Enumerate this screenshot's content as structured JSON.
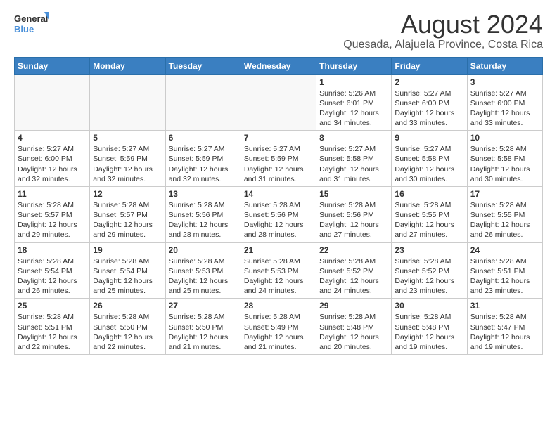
{
  "logo": {
    "line1": "General",
    "line2": "Blue"
  },
  "title": "August 2024",
  "subtitle": "Quesada, Alajuela Province, Costa Rica",
  "days_header": [
    "Sunday",
    "Monday",
    "Tuesday",
    "Wednesday",
    "Thursday",
    "Friday",
    "Saturday"
  ],
  "weeks": [
    [
      {
        "day": "",
        "info": ""
      },
      {
        "day": "",
        "info": ""
      },
      {
        "day": "",
        "info": ""
      },
      {
        "day": "",
        "info": ""
      },
      {
        "day": "1",
        "info": "Sunrise: 5:26 AM\nSunset: 6:01 PM\nDaylight: 12 hours\nand 34 minutes."
      },
      {
        "day": "2",
        "info": "Sunrise: 5:27 AM\nSunset: 6:00 PM\nDaylight: 12 hours\nand 33 minutes."
      },
      {
        "day": "3",
        "info": "Sunrise: 5:27 AM\nSunset: 6:00 PM\nDaylight: 12 hours\nand 33 minutes."
      }
    ],
    [
      {
        "day": "4",
        "info": "Sunrise: 5:27 AM\nSunset: 6:00 PM\nDaylight: 12 hours\nand 32 minutes."
      },
      {
        "day": "5",
        "info": "Sunrise: 5:27 AM\nSunset: 5:59 PM\nDaylight: 12 hours\nand 32 minutes."
      },
      {
        "day": "6",
        "info": "Sunrise: 5:27 AM\nSunset: 5:59 PM\nDaylight: 12 hours\nand 32 minutes."
      },
      {
        "day": "7",
        "info": "Sunrise: 5:27 AM\nSunset: 5:59 PM\nDaylight: 12 hours\nand 31 minutes."
      },
      {
        "day": "8",
        "info": "Sunrise: 5:27 AM\nSunset: 5:58 PM\nDaylight: 12 hours\nand 31 minutes."
      },
      {
        "day": "9",
        "info": "Sunrise: 5:27 AM\nSunset: 5:58 PM\nDaylight: 12 hours\nand 30 minutes."
      },
      {
        "day": "10",
        "info": "Sunrise: 5:28 AM\nSunset: 5:58 PM\nDaylight: 12 hours\nand 30 minutes."
      }
    ],
    [
      {
        "day": "11",
        "info": "Sunrise: 5:28 AM\nSunset: 5:57 PM\nDaylight: 12 hours\nand 29 minutes."
      },
      {
        "day": "12",
        "info": "Sunrise: 5:28 AM\nSunset: 5:57 PM\nDaylight: 12 hours\nand 29 minutes."
      },
      {
        "day": "13",
        "info": "Sunrise: 5:28 AM\nSunset: 5:56 PM\nDaylight: 12 hours\nand 28 minutes."
      },
      {
        "day": "14",
        "info": "Sunrise: 5:28 AM\nSunset: 5:56 PM\nDaylight: 12 hours\nand 28 minutes."
      },
      {
        "day": "15",
        "info": "Sunrise: 5:28 AM\nSunset: 5:56 PM\nDaylight: 12 hours\nand 27 minutes."
      },
      {
        "day": "16",
        "info": "Sunrise: 5:28 AM\nSunset: 5:55 PM\nDaylight: 12 hours\nand 27 minutes."
      },
      {
        "day": "17",
        "info": "Sunrise: 5:28 AM\nSunset: 5:55 PM\nDaylight: 12 hours\nand 26 minutes."
      }
    ],
    [
      {
        "day": "18",
        "info": "Sunrise: 5:28 AM\nSunset: 5:54 PM\nDaylight: 12 hours\nand 26 minutes."
      },
      {
        "day": "19",
        "info": "Sunrise: 5:28 AM\nSunset: 5:54 PM\nDaylight: 12 hours\nand 25 minutes."
      },
      {
        "day": "20",
        "info": "Sunrise: 5:28 AM\nSunset: 5:53 PM\nDaylight: 12 hours\nand 25 minutes."
      },
      {
        "day": "21",
        "info": "Sunrise: 5:28 AM\nSunset: 5:53 PM\nDaylight: 12 hours\nand 24 minutes."
      },
      {
        "day": "22",
        "info": "Sunrise: 5:28 AM\nSunset: 5:52 PM\nDaylight: 12 hours\nand 24 minutes."
      },
      {
        "day": "23",
        "info": "Sunrise: 5:28 AM\nSunset: 5:52 PM\nDaylight: 12 hours\nand 23 minutes."
      },
      {
        "day": "24",
        "info": "Sunrise: 5:28 AM\nSunset: 5:51 PM\nDaylight: 12 hours\nand 23 minutes."
      }
    ],
    [
      {
        "day": "25",
        "info": "Sunrise: 5:28 AM\nSunset: 5:51 PM\nDaylight: 12 hours\nand 22 minutes."
      },
      {
        "day": "26",
        "info": "Sunrise: 5:28 AM\nSunset: 5:50 PM\nDaylight: 12 hours\nand 22 minutes."
      },
      {
        "day": "27",
        "info": "Sunrise: 5:28 AM\nSunset: 5:50 PM\nDaylight: 12 hours\nand 21 minutes."
      },
      {
        "day": "28",
        "info": "Sunrise: 5:28 AM\nSunset: 5:49 PM\nDaylight: 12 hours\nand 21 minutes."
      },
      {
        "day": "29",
        "info": "Sunrise: 5:28 AM\nSunset: 5:48 PM\nDaylight: 12 hours\nand 20 minutes."
      },
      {
        "day": "30",
        "info": "Sunrise: 5:28 AM\nSunset: 5:48 PM\nDaylight: 12 hours\nand 19 minutes."
      },
      {
        "day": "31",
        "info": "Sunrise: 5:28 AM\nSunset: 5:47 PM\nDaylight: 12 hours\nand 19 minutes."
      }
    ]
  ]
}
